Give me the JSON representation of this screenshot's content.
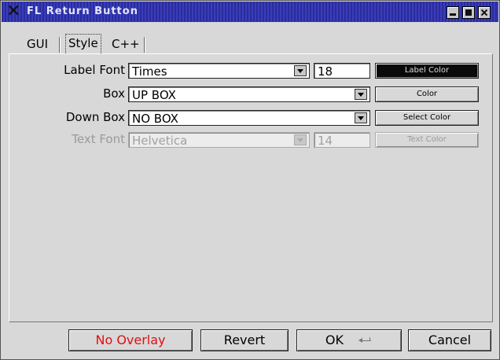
{
  "window": {
    "title": "FL Return Button",
    "icon": "x-logo-icon",
    "controls": [
      "minimize-icon",
      "maximize-icon",
      "close-icon"
    ]
  },
  "tabs": [
    {
      "label": "GUI",
      "active": false
    },
    {
      "label": "Style",
      "active": true
    },
    {
      "label": "C++",
      "active": false
    }
  ],
  "style": {
    "label_font": {
      "label": "Label Font",
      "value": "Times",
      "size": "18",
      "color_button": "Label Color"
    },
    "box": {
      "label": "Box",
      "value": "UP BOX",
      "color_button": "Color"
    },
    "down_box": {
      "label": "Down Box",
      "value": "NO BOX",
      "color_button": "Select Color"
    },
    "text_font": {
      "label": "Text Font",
      "value": "Helvetica",
      "size": "14",
      "color_button": "Text Color",
      "disabled": true
    }
  },
  "buttons": {
    "no_overlay": "No Overlay",
    "revert": "Revert",
    "ok": "OK",
    "cancel": "Cancel"
  },
  "colors": {
    "title_bar": "#3a3dbb",
    "no_overlay_text": "#e01010",
    "window_bg": "#d8d8d8"
  }
}
